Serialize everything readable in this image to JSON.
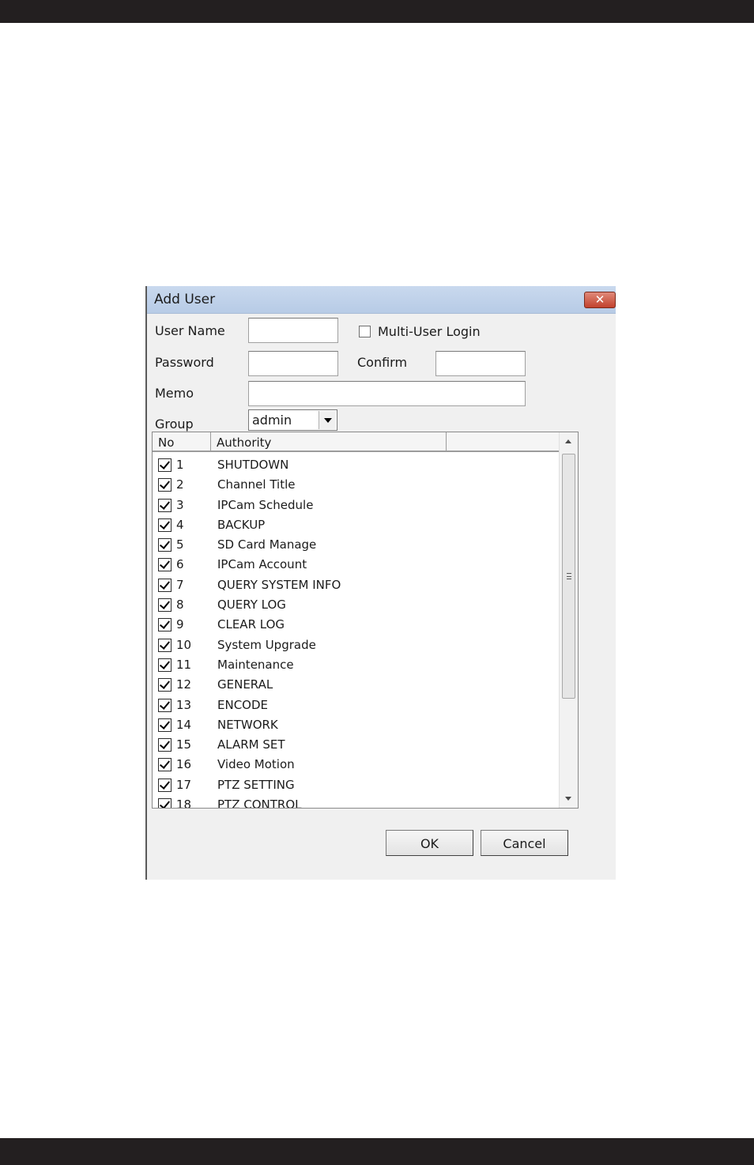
{
  "dialog": {
    "title": "Add User",
    "close_label": "✕"
  },
  "form": {
    "user_name_label": "User Name",
    "user_name_value": "",
    "multi_user_label": "Multi-User Login",
    "password_label": "Password",
    "password_value": "",
    "confirm_label": "Confirm",
    "confirm_value": "",
    "memo_label": "Memo",
    "memo_value": "",
    "group_label": "Group",
    "group_value": "admin"
  },
  "list": {
    "columns": [
      "No",
      "Authority",
      ""
    ],
    "rows": [
      {
        "no": "1",
        "authority": "SHUTDOWN",
        "checked": true
      },
      {
        "no": "2",
        "authority": "Channel Title",
        "checked": true
      },
      {
        "no": "3",
        "authority": "IPCam Schedule",
        "checked": true
      },
      {
        "no": "4",
        "authority": "BACKUP",
        "checked": true
      },
      {
        "no": "5",
        "authority": "SD Card Manage",
        "checked": true
      },
      {
        "no": "6",
        "authority": "IPCam Account",
        "checked": true
      },
      {
        "no": "7",
        "authority": "QUERY SYSTEM INFO",
        "checked": true
      },
      {
        "no": "8",
        "authority": "QUERY LOG",
        "checked": true
      },
      {
        "no": "9",
        "authority": "CLEAR LOG",
        "checked": true
      },
      {
        "no": "10",
        "authority": "System Upgrade",
        "checked": true
      },
      {
        "no": "11",
        "authority": "Maintenance",
        "checked": true
      },
      {
        "no": "12",
        "authority": "GENERAL",
        "checked": true
      },
      {
        "no": "13",
        "authority": "ENCODE",
        "checked": true
      },
      {
        "no": "14",
        "authority": "NETWORK",
        "checked": true
      },
      {
        "no": "15",
        "authority": "ALARM SET",
        "checked": true
      },
      {
        "no": "16",
        "authority": "Video Motion",
        "checked": true
      },
      {
        "no": "17",
        "authority": "PTZ SETTING",
        "checked": true
      },
      {
        "no": "18",
        "authority": "PTZ CONTROL",
        "checked": true
      }
    ]
  },
  "buttons": {
    "ok": "OK",
    "cancel": "Cancel"
  }
}
